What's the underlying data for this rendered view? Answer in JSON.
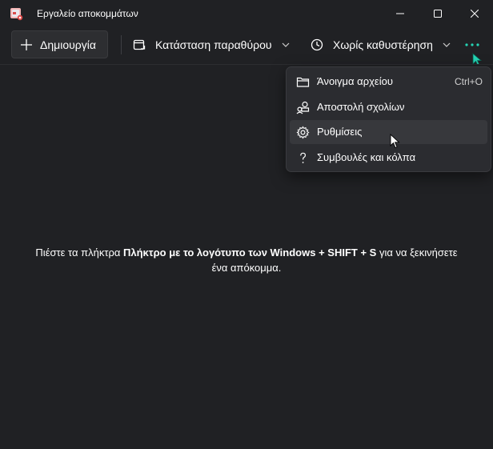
{
  "app": {
    "title": "Εργαλείο αποκομμάτων"
  },
  "toolbar": {
    "new_label": "Δημιουργία",
    "mode_label": "Κατάσταση παραθύρου",
    "delay_label": "Χωρίς καθυστέρηση"
  },
  "menu": {
    "items": [
      {
        "label": "Άνοιγμα αρχείου",
        "shortcut": "Ctrl+O",
        "icon": "folder-icon"
      },
      {
        "label": "Αποστολή σχολίων",
        "shortcut": "",
        "icon": "feedback-icon"
      },
      {
        "label": "Ρυθμίσεις",
        "shortcut": "",
        "icon": "gear-icon"
      },
      {
        "label": "Συμβουλές και κόλπα",
        "shortcut": "",
        "icon": "question-icon"
      }
    ]
  },
  "main": {
    "hint_prefix": "Πιέστε τα πλήκτρα ",
    "hint_bold": "Πλήκτρο με το λογότυπο των Windows + SHIFT + S",
    "hint_suffix": " για να ξεκινήσετε",
    "hint_line2": "ένα απόκομμα."
  },
  "colors": {
    "background": "#202124",
    "menu_background": "#2b2c30",
    "accent_teal": "#25d4b4"
  }
}
